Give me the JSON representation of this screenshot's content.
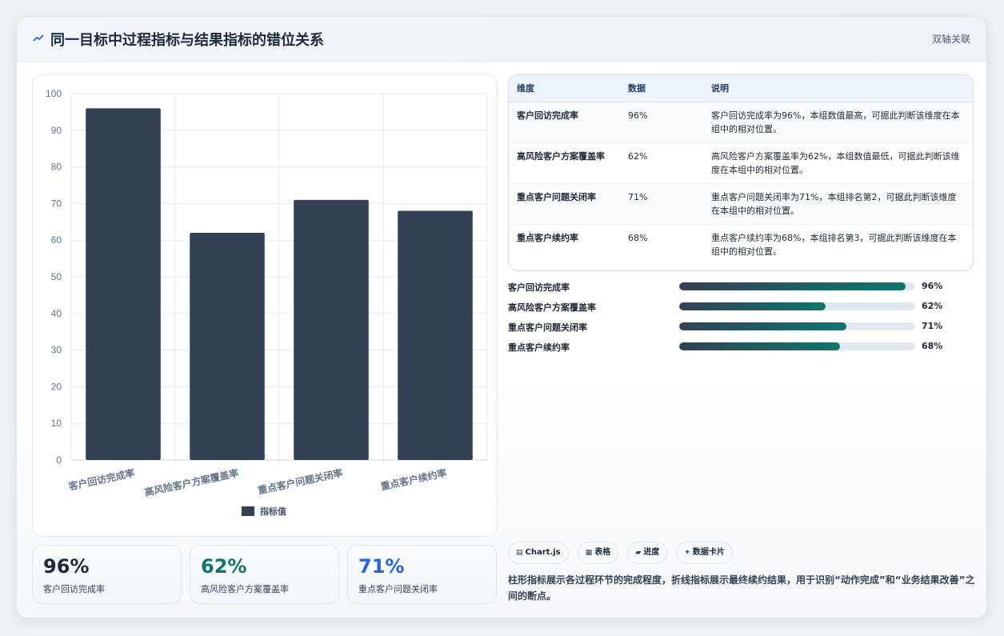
{
  "header": {
    "title": "同一目标中过程指标与结果指标的错位关系",
    "tag": "双轴关联"
  },
  "colors": {
    "bar": "#334155",
    "accent_teal": "#0f766e",
    "accent_blue": "#2563eb",
    "dark": "#1e293b"
  },
  "chart_data": {
    "type": "bar",
    "categories": [
      "客户回访完成率",
      "高风险客户方案覆盖率",
      "重点客户问题关闭率",
      "重点客户续约率"
    ],
    "series": [
      {
        "name": "指标值",
        "values": [
          96,
          62,
          71,
          68
        ]
      }
    ],
    "ylim": [
      0,
      100
    ],
    "yticks": [
      0,
      10,
      20,
      30,
      40,
      50,
      60,
      70,
      80,
      90,
      100
    ],
    "legend": "bottom",
    "grid": true
  },
  "table": {
    "headers": [
      "维度",
      "数据",
      "说明"
    ],
    "rows": [
      {
        "dim": "客户回访完成率",
        "value": "96%",
        "desc": "客户回访完成率为96%，本组数值最高，可据此判断该维度在本组中的相对位置。"
      },
      {
        "dim": "高风险客户方案覆盖率",
        "value": "62%",
        "desc": "高风险客户方案覆盖率为62%，本组数值最低，可据此判断该维度在本组中的相对位置。"
      },
      {
        "dim": "重点客户问题关闭率",
        "value": "71%",
        "desc": "重点客户问题关闭率为71%，本组排名第2，可据此判断该维度在本组中的相对位置。"
      },
      {
        "dim": "重点客户续约率",
        "value": "68%",
        "desc": "重点客户续约率为68%，本组排名第3，可据此判断该维度在本组中的相对位置。"
      }
    ]
  },
  "progress": [
    {
      "label": "客户回访完成率",
      "value": "96%",
      "fraction": 0.96
    },
    {
      "label": "高风险客户方案覆盖率",
      "value": "62%",
      "fraction": 0.62
    },
    {
      "label": "重点客户问题关闭率",
      "value": "71%",
      "fraction": 0.71
    },
    {
      "label": "重点客户续约率",
      "value": "68%",
      "fraction": 0.68
    }
  ],
  "kpis": [
    {
      "value": "96%",
      "label": "客户回访完成率",
      "color": "#1e293b"
    },
    {
      "value": "62%",
      "label": "高风险客户方案覆盖率",
      "color": "#0f766e"
    },
    {
      "value": "71%",
      "label": "重点客户问题关闭率",
      "color": "#2563eb"
    }
  ],
  "chips": [
    {
      "icon": "chart-icon",
      "label": "Chart.js"
    },
    {
      "icon": "table-icon",
      "label": "表格"
    },
    {
      "icon": "progress-icon",
      "label": "进度"
    },
    {
      "icon": "sparkle-icon",
      "label": "数据卡片"
    }
  ],
  "footnote": "柱形指标展示各过程环节的完成程度，折线指标展示最终续约结果，用于识别“动作完成”和“业务结果改善”之间的断点。"
}
